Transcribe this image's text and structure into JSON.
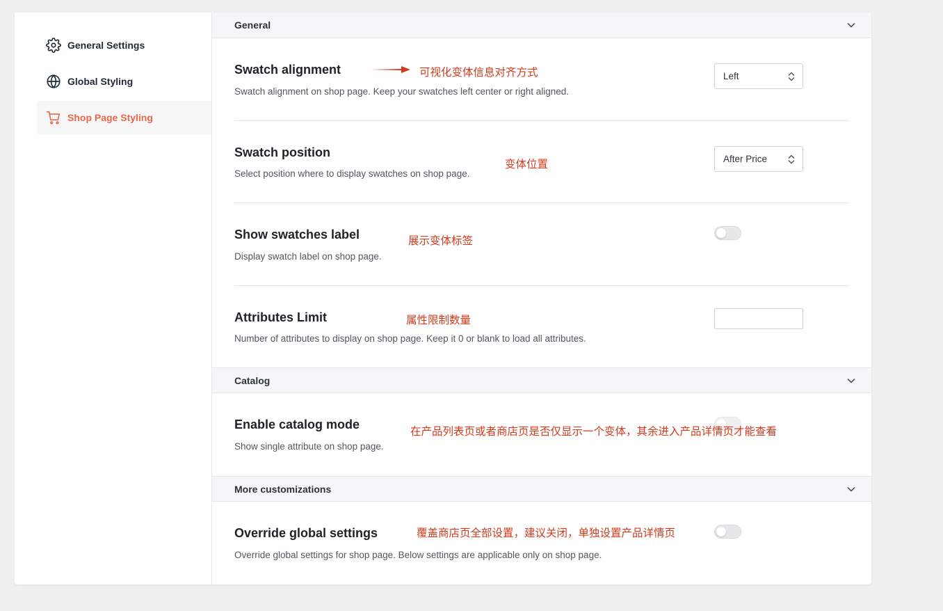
{
  "sidebar": {
    "items": [
      {
        "label": "General Settings",
        "icon": "gear-icon"
      },
      {
        "label": "Global Styling",
        "icon": "globe-icon"
      },
      {
        "label": "Shop Page Styling",
        "icon": "cart-icon",
        "active": true
      }
    ],
    "accent_color": "#e8694a"
  },
  "sections": {
    "general": {
      "label": "General"
    },
    "catalog": {
      "label": "Catalog"
    },
    "more": {
      "label": "More customizations"
    }
  },
  "settings": {
    "swatch_alignment": {
      "title": "Swatch alignment",
      "desc": "Swatch alignment on shop page. Keep your swatches left center or right aligned.",
      "value": "Left"
    },
    "swatch_position": {
      "title": "Swatch position",
      "desc": "Select position where to display swatches on shop page.",
      "value": "After Price"
    },
    "show_label": {
      "title": "Show swatches label",
      "desc": "Display swatch label on shop page.",
      "enabled": false
    },
    "attributes_limit": {
      "title": "Attributes Limit",
      "desc": "Number of attributes to display on shop page. Keep it 0 or blank to load all attributes.",
      "value": ""
    },
    "catalog_mode": {
      "title": "Enable catalog mode",
      "desc": "Show single attribute on shop page.",
      "enabled": false
    },
    "override_global": {
      "title": "Override global settings",
      "desc": "Override global settings for shop page. Below settings are applicable only on shop page.",
      "enabled": false
    }
  },
  "annotations": {
    "a1": "可视化变体信息对齐方式",
    "a2": "变体位置",
    "a3": "展示变体标签",
    "a4": "属性限制数量",
    "a5": "在产品列表页或者商店页是否仅显示一个变体，其余进入产品详情页才能查看",
    "a6": "覆盖商店页全部设置，建议关闭，单独设置产品详情页",
    "color": "#d33a1c"
  }
}
